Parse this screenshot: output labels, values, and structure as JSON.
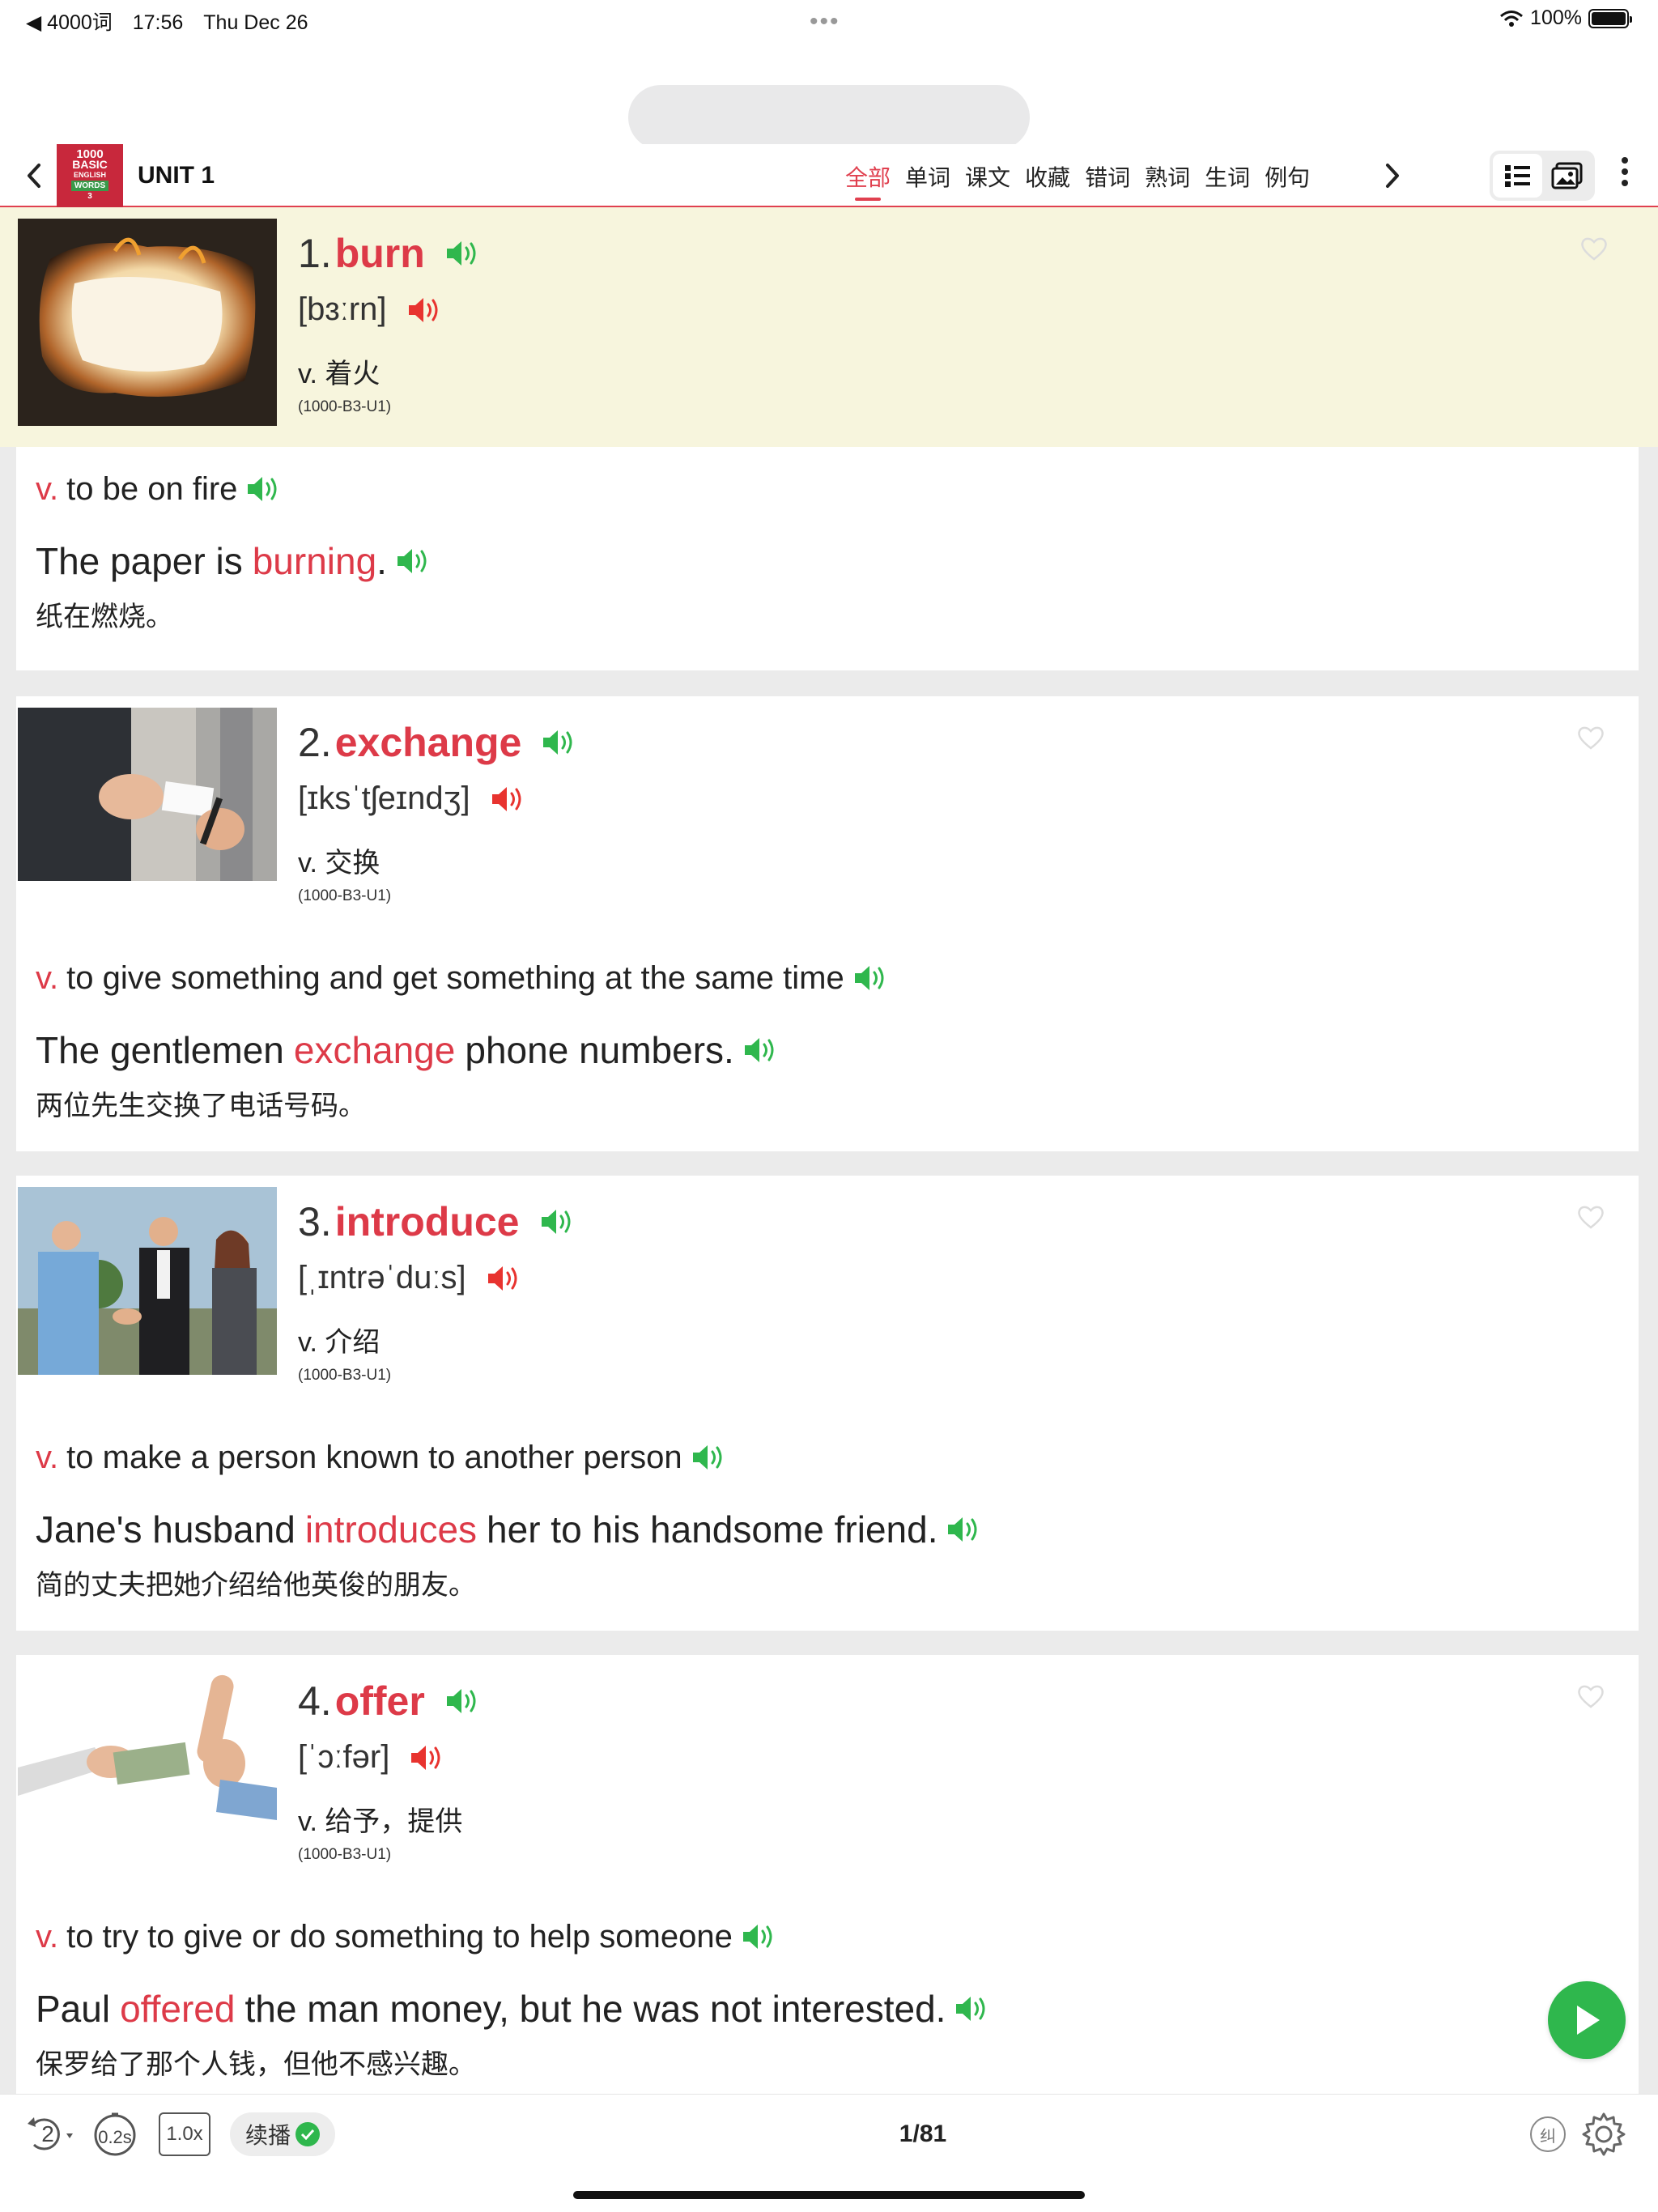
{
  "status": {
    "back_app": "◀ 4000词",
    "time": "17:56",
    "date": "Thu Dec 26",
    "battery": "100%"
  },
  "header": {
    "title": "UNIT 1",
    "cover_lines": [
      "1000",
      "BASIC",
      "ENGLISH",
      "WORDS",
      "3"
    ],
    "tabs": [
      "全部",
      "单词",
      "课文",
      "收藏",
      "错词",
      "熟词",
      "生词",
      "例句"
    ],
    "active_tab": "全部"
  },
  "words": [
    {
      "num": "1.",
      "word": "burn",
      "phonetic": "[bɜːrn]",
      "pos_cn": "v. 着火",
      "code": "(1000-B3-U1)",
      "def_pos": "v.",
      "definition": "to be on fire",
      "ex_before": "The paper is",
      "ex_word": "burning",
      "ex_after": ".",
      "translation": "纸在燃烧。"
    },
    {
      "num": "2.",
      "word": "exchange",
      "phonetic": "[ɪksˈtʃeɪndʒ]",
      "pos_cn": "v. 交换",
      "code": "(1000-B3-U1)",
      "def_pos": "v.",
      "definition": "to give something and get something at the same time",
      "ex_before": "The gentlemen",
      "ex_word": "exchange",
      "ex_after": "phone numbers.",
      "translation": "两位先生交换了电话号码。"
    },
    {
      "num": "3.",
      "word": "introduce",
      "phonetic": "[ˌɪntrəˈduːs]",
      "pos_cn": "v. 介绍",
      "code": "(1000-B3-U1)",
      "def_pos": "v.",
      "definition": "to make a person known to another person",
      "ex_before": "Jane's husband",
      "ex_word": "introduces",
      "ex_after": "her to his handsome friend.",
      "translation": "简的丈夫把她介绍给他英俊的朋友。"
    },
    {
      "num": "4.",
      "word": "offer",
      "phonetic": "[ˈɔːfər]",
      "pos_cn": "v. 给予，提供",
      "code": "(1000-B3-U1)",
      "def_pos": "v.",
      "definition": "to try to give or do something to help someone",
      "ex_before": "Paul",
      "ex_word": "offered",
      "ex_after": "the man money, but he was not interested.",
      "translation": "保罗给了那个人钱，但他不感兴趣。"
    }
  ],
  "toolbar": {
    "repeat": "2",
    "interval": "0.2s",
    "speed": "1.0x",
    "continue_label": "续播",
    "page": "1/81",
    "correct_label": "纠"
  },
  "colors": {
    "accent": "#dd3a48",
    "speaker_green": "#2fb74d",
    "speaker_red": "#e8332f",
    "highlight_bg": "#f7f5dd"
  }
}
